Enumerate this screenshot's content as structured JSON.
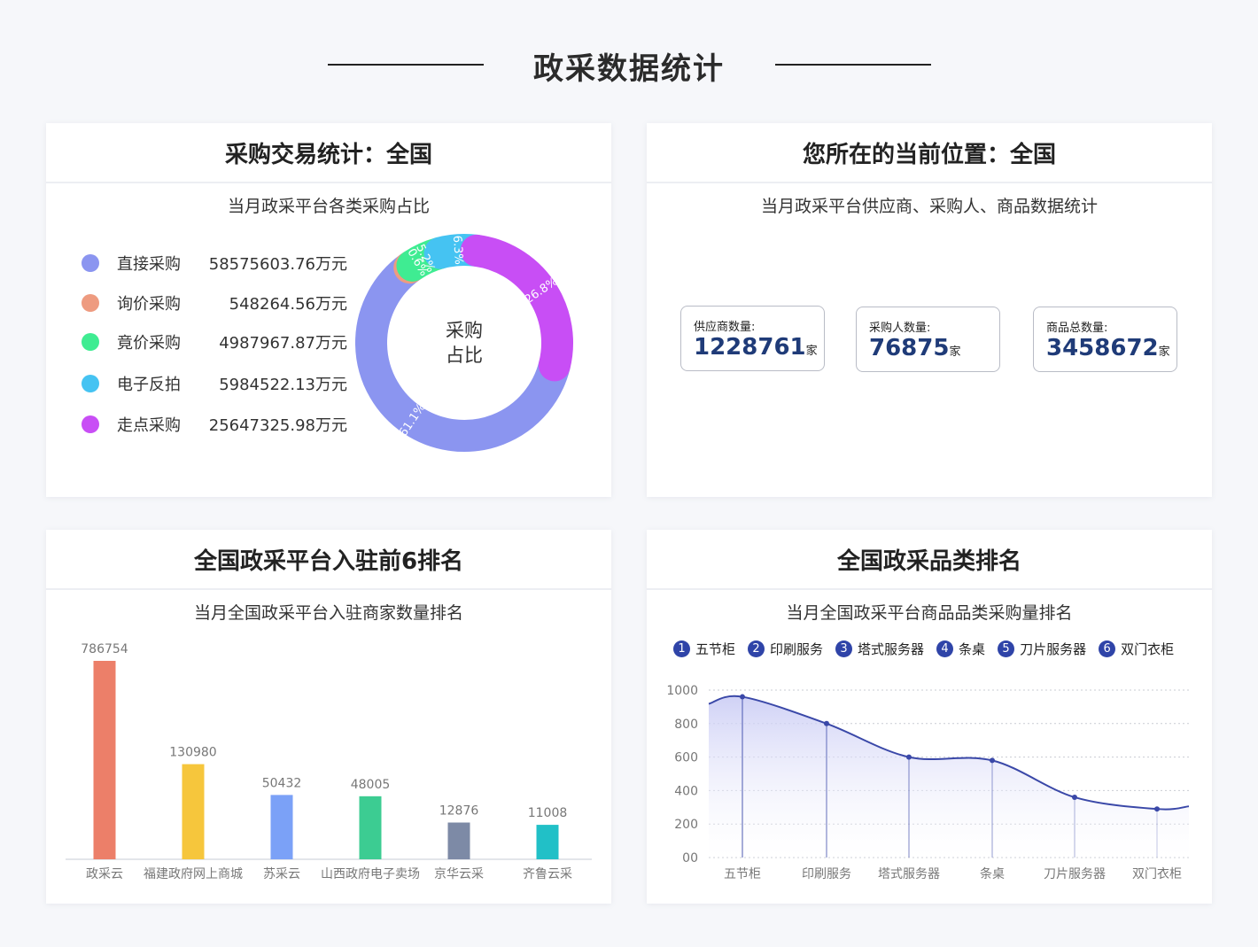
{
  "page": {
    "title": "政采数据统计"
  },
  "card1": {
    "title": "采购交易统计：全国",
    "subtitle": "当月政采平台各类采购占比",
    "center_label_1": "采购",
    "center_label_2": "占比",
    "items": [
      {
        "name": "直接采购",
        "value": "58575603.76万元",
        "color": "#8b95f0"
      },
      {
        "name": "询价采购",
        "value": "548264.56万元",
        "color": "#ee9b80"
      },
      {
        "name": "竟价采购",
        "value": "4987967.87万元",
        "color": "#3fec92"
      },
      {
        "name": "电子反拍",
        "value": "5984522.13万元",
        "color": "#45c3f2"
      },
      {
        "name": "走点采购",
        "value": "25647325.98万元",
        "color": "#c84ef5"
      }
    ]
  },
  "card2": {
    "title": "您所在的当前位置：全国",
    "subtitle": "当月政采平台供应商、采购人、商品数据统计",
    "stats": [
      {
        "label": "供应商数量:",
        "value": "1228761",
        "unit": "家"
      },
      {
        "label": "采购人数量:",
        "value": "76875",
        "unit": "家"
      },
      {
        "label": "商品总数量:",
        "value": "3458672",
        "unit": "家"
      }
    ]
  },
  "card3": {
    "title": "全国政采平台入驻前6排名",
    "subtitle": "当月全国政采平台入驻商家数量排名"
  },
  "card4": {
    "title": "全国政采品类排名",
    "subtitle": "当月全国政采平台商品品类采购量排名",
    "ranking": [
      {
        "num": "1",
        "name": "五节柜"
      },
      {
        "num": "2",
        "name": "印刷服务"
      },
      {
        "num": "3",
        "name": "塔式服务器"
      },
      {
        "num": "4",
        "name": "条桌"
      },
      {
        "num": "5",
        "name": "刀片服务器"
      },
      {
        "num": "6",
        "name": "双门衣柜"
      }
    ]
  },
  "chart_data": [
    {
      "type": "pie",
      "title": "",
      "categories": [
        "直接采购",
        "询价采购",
        "竟价采购",
        "电子反拍",
        "走点采购"
      ],
      "values": [
        61.1,
        0.6,
        5.2,
        6.3,
        26.8
      ],
      "labels": [
        "61.1%",
        "0.6%",
        "5.2%",
        "6.3%",
        "26.8%"
      ],
      "colors": [
        "#8b95f0",
        "#ee9b80",
        "#3fec92",
        "#45c3f2",
        "#c84ef5"
      ],
      "donut": true
    },
    {
      "type": "bar",
      "title": "",
      "categories": [
        "政采云",
        "福建政府网上商城",
        "苏采云",
        "山西政府电子卖场",
        "京华云采",
        "齐鲁云采"
      ],
      "values": [
        786754,
        130980,
        50432,
        48005,
        12876,
        11008
      ],
      "colors": [
        "#ec7f69",
        "#f6c63c",
        "#7ba1f7",
        "#3ccc92",
        "#7d8aa6",
        "#21c0c7"
      ],
      "grid": false
    },
    {
      "type": "area",
      "title": "",
      "categories": [
        "五节柜",
        "印刷服务",
        "塔式服务器",
        "条桌",
        "刀片服务器",
        "双门衣柜"
      ],
      "values": [
        960,
        800,
        600,
        580,
        360,
        290
      ],
      "y_tick_labels": [
        "00",
        "200",
        "400",
        "600",
        "800",
        "1000"
      ],
      "ylim": [
        0,
        1000
      ],
      "grid": true,
      "color": "#3a48a8"
    }
  ]
}
